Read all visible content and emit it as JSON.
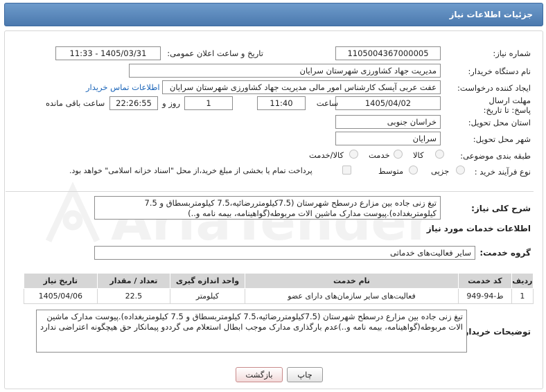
{
  "header": {
    "title": "جزئیات اطلاعات نیاز"
  },
  "fields": {
    "need_number_label": "شماره نیاز:",
    "need_number": "1105004367000005",
    "announce_label": "تاریخ و ساعت اعلان عمومی:",
    "announce_value": "1405/03/31 - 11:33",
    "buyer_org_label": "نام دستگاه خریدار:",
    "buyer_org": "مدیریت جهاد کشاورزی شهرستان سرایان",
    "creator_label": "ایجاد کننده درخواست:",
    "creator": "عفت عربی آیسک کارشناس امور مالی مدیریت جهاد کشاورزی شهرستان سرایان",
    "contact_link": "اطلاعات تماس خریدار",
    "deadline_label": "مهلت ارسال پاسخ: تا تاریخ:",
    "deadline_date": "1405/04/02",
    "time_label": "ساعت",
    "deadline_time": "11:40",
    "days_value": "1",
    "days_label": "روز و",
    "remaining_time": "22:26:55",
    "remaining_label": "ساعت باقی مانده",
    "province_label": "استان محل تحویل:",
    "province": "خراسان جنوبی",
    "city_label": "شهر محل تحویل:",
    "city": "سرایان",
    "category_label": "طبقه بندی موضوعی:",
    "category_options": [
      "کالا",
      "خدمت",
      "کالا/خدمت"
    ],
    "process_label": "نوع فرآیند خرید :",
    "process_options": [
      "جزیی",
      "متوسط"
    ],
    "payment_note": "پرداخت تمام یا بخشی از مبلغ خرید،از محل \"اسناد خزانه اسلامی\" خواهد بود."
  },
  "summary": {
    "label": "شرح کلی نیاز:",
    "text": "تیغ زنی جاده بین مزارع درسطح شهرستان (7.5کیلومتررضائیه،7.5 کیلومتربسطاق و 7.5 کیلومتربغداده).پیوست مدارک ماشین الات مربوطه(گواهینامه، بیمه نامه و..)"
  },
  "services": {
    "section_title": "اطلاعات خدمات مورد نیاز",
    "group_label": "گروه خدمت:",
    "group_value": "سایر فعالیت‌های خدماتی",
    "columns": [
      "ردیف",
      "کد خدمت",
      "نام خدمت",
      "واحد اندازه گیری",
      "تعداد / مقدار",
      "تاریخ نیاز"
    ],
    "rows": [
      [
        "1",
        "ط-94-949",
        "فعالیت‌های سایر سازمان‌های دارای عضو",
        "کیلومتر",
        "22.5",
        "1405/04/06"
      ]
    ]
  },
  "buyer_notes": {
    "label": "توضیحات خریدار:",
    "text": "تیغ زنی جاده بین مزارع درسطح شهرستان (7.5کیلومتررضائیه،7.5 کیلومتربسطاق و 7.5 کیلومتربغداده).پیوست مدارک ماشین الات مربوطه(گواهینامه، بیمه نامه و..)عدم بارگذاری مدارک موجب ابطال استعلام می گرددو پیمانکار حق هیچگونه اعتراضی ندارد"
  },
  "buttons": {
    "print": "چاپ",
    "back": "بازگشت"
  },
  "watermark": {
    "text": "AriaTender.net"
  },
  "colors": {
    "header": "#5a87bb",
    "link": "#1a64b8"
  }
}
